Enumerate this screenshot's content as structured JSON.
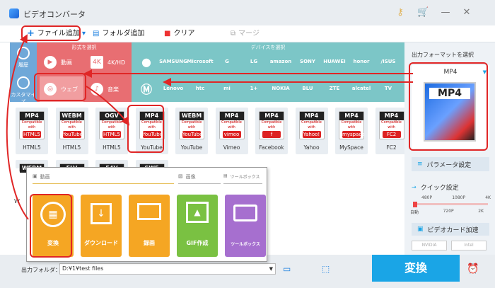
{
  "app": {
    "title": "ビデオコンバータ"
  },
  "toolbar": {
    "add_file": "ファイル追加",
    "add_folder": "フォルダ追加",
    "clear": "クリア",
    "merge": "マージ"
  },
  "left": {
    "recent": "履歴",
    "custom": "カスタマイズ"
  },
  "categories": {
    "format_header": "形式を選択",
    "device_header": "デバイスを選択",
    "format_items": [
      "動画",
      "4K/HD",
      "ウェブ",
      "音楽"
    ],
    "brands_row1": [
      "",
      "SAMSUNG",
      "Microsoft",
      "G",
      "LG",
      "amazon",
      "SONY",
      "HUAWEI",
      "honor",
      "/ISUS"
    ],
    "brands_row2": [
      "",
      "Lenovo",
      "htc",
      "mi",
      "1+",
      "NOKIA",
      "BLU",
      "ZTE",
      "alcatel",
      "TV"
    ]
  },
  "tiles_row1": [
    {
      "head": "MP4",
      "mark": "HTML5",
      "label": "HTML5"
    },
    {
      "head": "WEBM",
      "mark": "YouTube",
      "label": "HTML5"
    },
    {
      "head": "OGV",
      "mark": "HTML5",
      "label": "HTML5"
    },
    {
      "head": "MP4",
      "mark": "YouTube",
      "label": "YouTube"
    },
    {
      "head": "WEBM",
      "mark": "YouTube",
      "label": "YouTube"
    },
    {
      "head": "MP4",
      "mark": "vimeo",
      "label": "Vimeo"
    },
    {
      "head": "MP4",
      "mark": "f",
      "label": "Facebook"
    },
    {
      "head": "MP4",
      "mark": "Yahoo!",
      "label": "Yahoo"
    },
    {
      "head": "MP4",
      "mark": "myspace",
      "label": "MySpace"
    },
    {
      "head": "MP4",
      "mark": "FC2",
      "label": "FC2"
    }
  ],
  "tiles_row2": [
    {
      "head": "WEBM"
    },
    {
      "head": "FLV"
    },
    {
      "head": "F4V"
    },
    {
      "head": "SWF"
    }
  ],
  "tile_subtext": "Compatible with",
  "tile_partial_label": "W",
  "right": {
    "select_format": "出力フォーマットを選択",
    "format_value": "MP4",
    "params": "パラメータ設定",
    "quick": "クイック設定",
    "q_top": [
      "480P",
      "1080P",
      "4K"
    ],
    "q_bottom": [
      "自動",
      "720P",
      "2K"
    ],
    "gpu": "ビデオカード加速",
    "nvidia": "NVIDIA",
    "intel": "Intel"
  },
  "popup": {
    "video": "動画",
    "image": "画像",
    "toolbox": "ツールボックス",
    "cards": [
      "変換",
      "ダウンロード",
      "録画",
      "GIF作成",
      "ツールボックス"
    ]
  },
  "bottom": {
    "folder_label": "出力フォルダ：",
    "folder_value": "D:¥1¥test files",
    "convert": "変換"
  },
  "colors": {
    "accent": "#1aa5e6",
    "red": "#e02626",
    "format_red": "#e86e72",
    "device_teal": "#7cc6c7"
  }
}
